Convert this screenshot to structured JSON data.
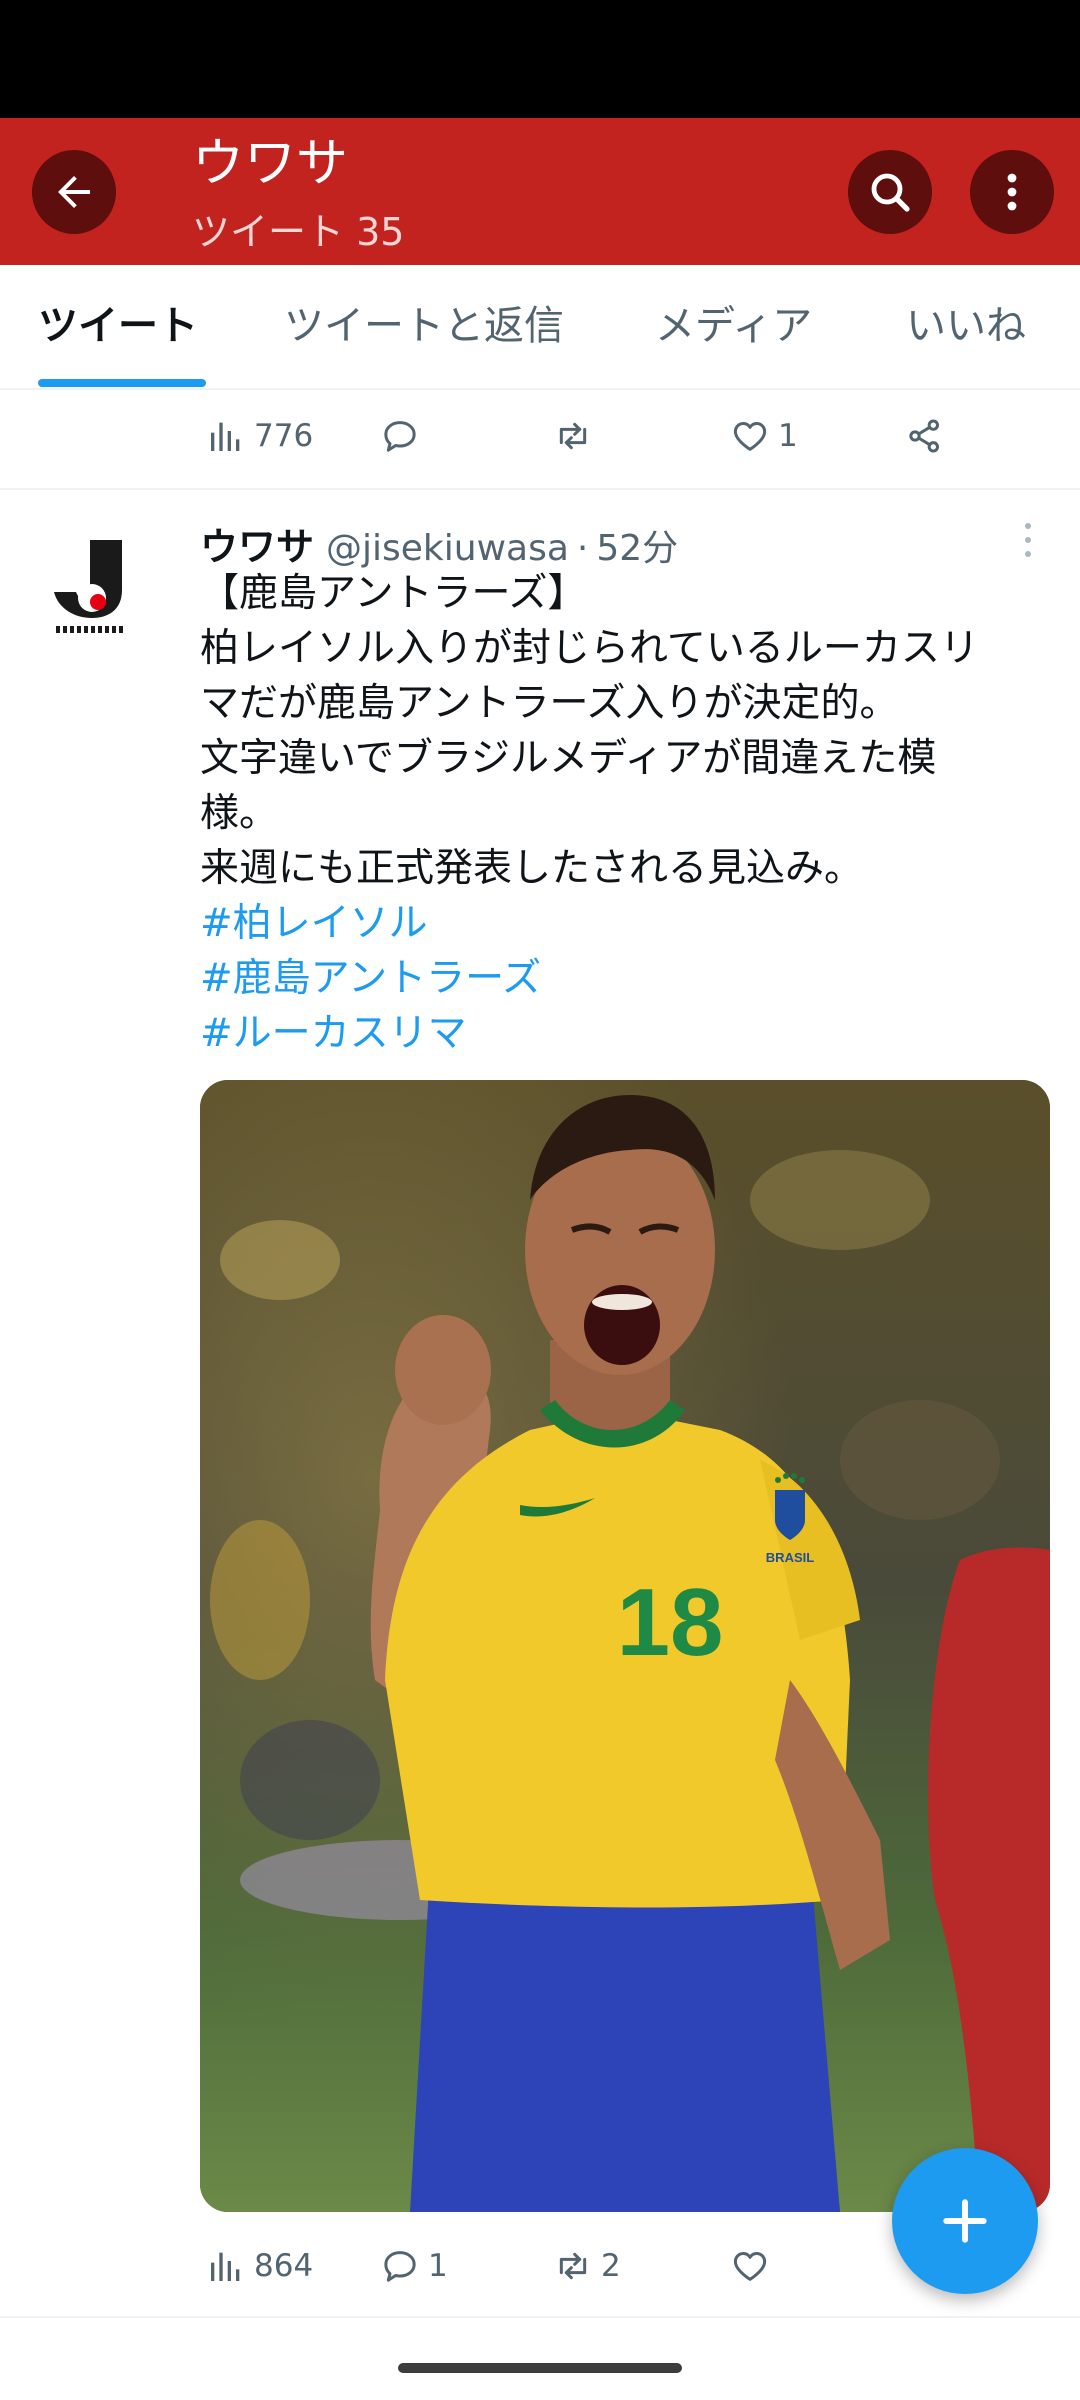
{
  "app_bar": {
    "title": "ウワサ",
    "subtitle": "ツイート 35",
    "back_icon": "arrow-left-icon",
    "search_icon": "search-icon",
    "more_icon": "more-vertical-icon",
    "color": "#c2231f"
  },
  "tabs": [
    {
      "label": "ツイート",
      "active": true
    },
    {
      "label": "ツイートと返信",
      "active": false
    },
    {
      "label": "メディア",
      "active": false
    },
    {
      "label": "いいね",
      "active": false
    }
  ],
  "prev_tweet_actions": {
    "views": "776",
    "replies": "",
    "retweets": "",
    "likes": "1"
  },
  "tweet": {
    "name": "ウワサ",
    "handle": "@jisekiuwasa",
    "separator": "·",
    "time": "52分",
    "avatar_icon": "jleague-logo-icon",
    "lines": [
      "【鹿島アントラーズ】",
      "柏レイソル入りが封じられているルーカスリ",
      "マだが鹿島アントラーズ入りが決定的。",
      "文字違いでブラジルメディアが間違えた模",
      "様。",
      "来週にも正式発表したされる見込み。"
    ],
    "hashtags": [
      "#柏レイソル",
      "#鹿島アントラーズ",
      "#ルーカスリマ"
    ],
    "jersey_number": "18",
    "jersey_text": "BRASIL",
    "actions": {
      "views": "864",
      "replies": "1",
      "retweets": "2",
      "likes": ""
    }
  },
  "fab_icon": "plus-icon",
  "accent_color": "#1d9bf0"
}
